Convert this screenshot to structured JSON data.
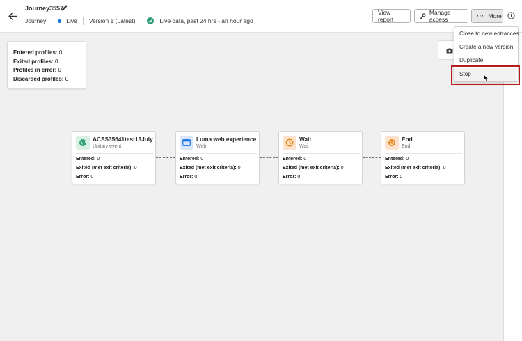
{
  "header": {
    "title": "Journey3557",
    "type_label": "Journey",
    "status": "Live",
    "version": "Version 1 (Latest)",
    "live_data": "Live data, past 24 hrs - an hour ago",
    "buttons": {
      "view_report": "View report",
      "manage_access": "Manage access",
      "more": "More"
    }
  },
  "stats": {
    "entered": {
      "label": "Entered profiles:",
      "value": "0"
    },
    "exited": {
      "label": "Exited profiles:",
      "value": "0"
    },
    "errors": {
      "label": "Profiles in error:",
      "value": "0"
    },
    "discarded": {
      "label": "Discarded profiles:",
      "value": "0"
    }
  },
  "nodes": [
    {
      "name": "ACSS35641test13July",
      "sub": "Unitary event",
      "icon": "globe-icon",
      "entered": "0",
      "exited": "0",
      "error": "0"
    },
    {
      "name": "Luma web experience",
      "sub": "Web",
      "icon": "browser-icon",
      "entered": "0",
      "exited": "0",
      "error": "0"
    },
    {
      "name": "Wait",
      "sub": "Wait",
      "icon": "clock-icon",
      "entered": "0",
      "exited": "0",
      "error": "0"
    },
    {
      "name": "End",
      "sub": "End",
      "icon": "stop-circle-icon",
      "entered": "0",
      "exited": "0",
      "error": "0"
    }
  ],
  "node_labels": {
    "entered": "Entered:",
    "exited": "Exited (met exit criteria):",
    "error": "Error:"
  },
  "menu": {
    "items": [
      "Close to new entrances",
      "Create a new version",
      "Duplicate",
      "Stop"
    ]
  },
  "colors": {
    "live_dot": "#1473e6",
    "success": "#2d9d78",
    "highlight": "#b91c1c",
    "event_icon_bg": "#d9f0e2",
    "web_icon_bg": "#dbe8fb",
    "wait_icon_bg": "#fde3cd",
    "end_icon_bg": "#fde3cd"
  }
}
